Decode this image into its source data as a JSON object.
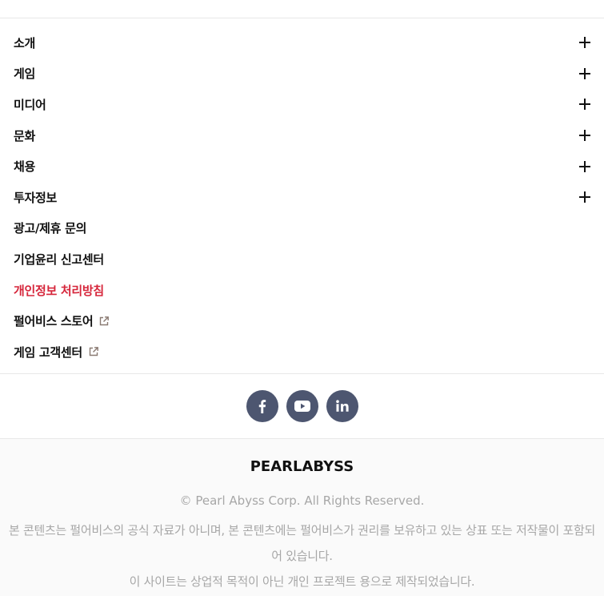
{
  "menu": {
    "items": [
      {
        "label": "소개",
        "expandable": true
      },
      {
        "label": "게임",
        "expandable": true
      },
      {
        "label": "미디어",
        "expandable": true
      },
      {
        "label": "문화",
        "expandable": true
      },
      {
        "label": "채용",
        "expandable": true
      },
      {
        "label": "투자정보",
        "expandable": true
      },
      {
        "label": "광고/제휴 문의",
        "expandable": false
      },
      {
        "label": "기업윤리 신고센터",
        "expandable": false
      },
      {
        "label": "개인정보 처리방침",
        "expandable": false,
        "active": true
      },
      {
        "label": "펄어비스 스토어",
        "expandable": false,
        "external": true
      },
      {
        "label": "게임 고객센터",
        "expandable": false,
        "external": true
      }
    ],
    "active_color": "#d6263b"
  },
  "social": {
    "buttons": [
      {
        "icon": "facebook-icon"
      },
      {
        "icon": "youtube-icon"
      },
      {
        "icon": "linkedin-icon"
      }
    ],
    "color": "#4d5670"
  },
  "footer": {
    "brand": "PEARLABYSS",
    "copyright": "© Pearl Abyss Corp. All Rights Reserved.",
    "notice_line1": "본 콘텐츠는 펄어비스의 공식 자료가 아니며, 본 콘텐츠에는 펄어비스가 권리를 보유하고 있는 상표 또는 저작물이 포함되어 있습니다.",
    "notice_line2": "이 사이트는 상업적 목적이 아닌 개인 프로젝트 용으로 제작되었습니다."
  }
}
